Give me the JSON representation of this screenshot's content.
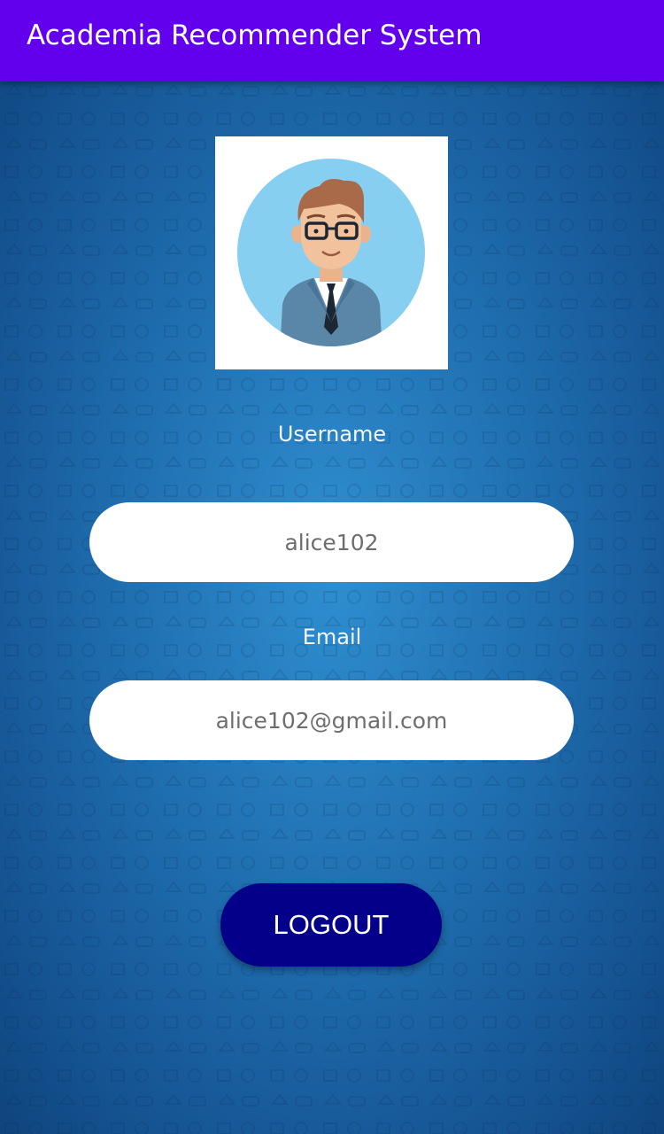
{
  "app_bar": {
    "title": "Academia Recommender System"
  },
  "profile": {
    "avatar_icon": "user-avatar-icon",
    "username_label": "Username",
    "username_value": "alice102",
    "email_label": "Email",
    "email_value": "alice102@gmail.com"
  },
  "actions": {
    "logout_label": "LOGOUT"
  },
  "colors": {
    "app_bar": "#6200ee",
    "background": "#1f6eaf",
    "logout_button": "#040089",
    "field_background": "#ffffff",
    "field_text": "#6e6e6e"
  }
}
